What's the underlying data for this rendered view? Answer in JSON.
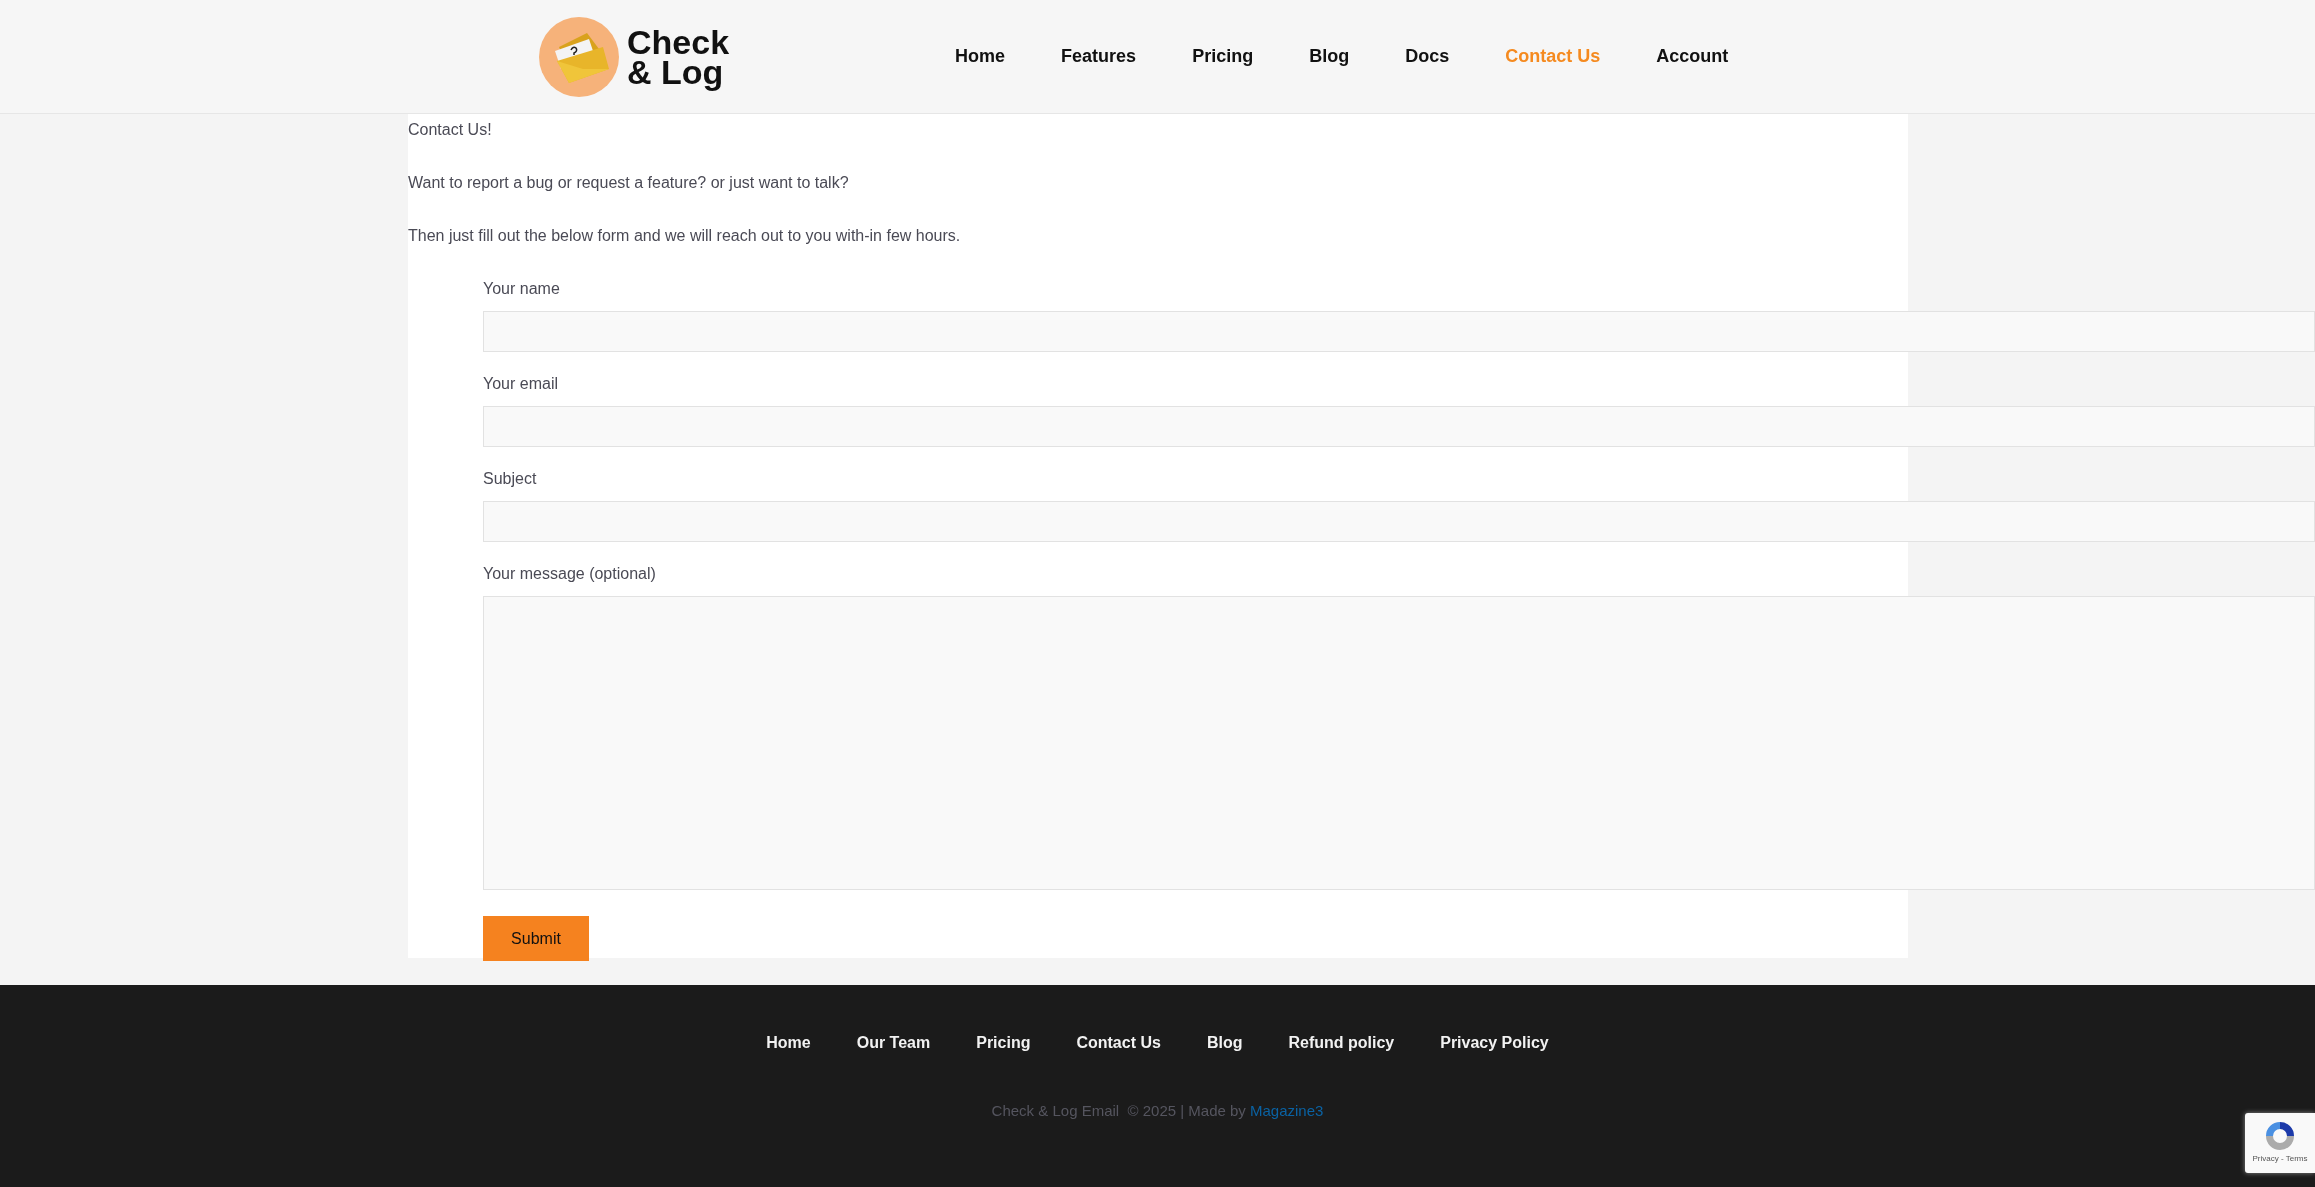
{
  "header": {
    "logo": {
      "line1": "Check",
      "line2": "& Log"
    },
    "nav": [
      {
        "label": "Home",
        "selected": false
      },
      {
        "label": "Features",
        "selected": false
      },
      {
        "label": "Pricing",
        "selected": false
      },
      {
        "label": "Blog",
        "selected": false
      },
      {
        "label": "Docs",
        "selected": false
      },
      {
        "label": "Contact Us",
        "selected": true
      },
      {
        "label": "Account",
        "selected": false
      }
    ]
  },
  "content": {
    "title": "Contact Us!",
    "paragraphs": [
      "Want to report a bug or request a feature? or just want to talk?",
      "Then just fill out the below form and we will reach out to you with-in few hours."
    ],
    "form": {
      "fields": [
        {
          "label": "Your name",
          "kind": "input"
        },
        {
          "label": "Your email",
          "kind": "input"
        },
        {
          "label": "Subject",
          "kind": "input"
        },
        {
          "label": "Your message (optional)",
          "kind": "textarea"
        }
      ],
      "submit": "Submit"
    }
  },
  "footer": {
    "links": [
      "Home",
      "Our Team",
      "Pricing",
      "Contact Us",
      "Blog",
      "Refund policy",
      "Privacy Policy"
    ],
    "copyright": "Check & Log Email  © 2025 | Made by",
    "credit_link": "Magazine3"
  },
  "recaptcha": {
    "links": "Privacy - Terms"
  }
}
